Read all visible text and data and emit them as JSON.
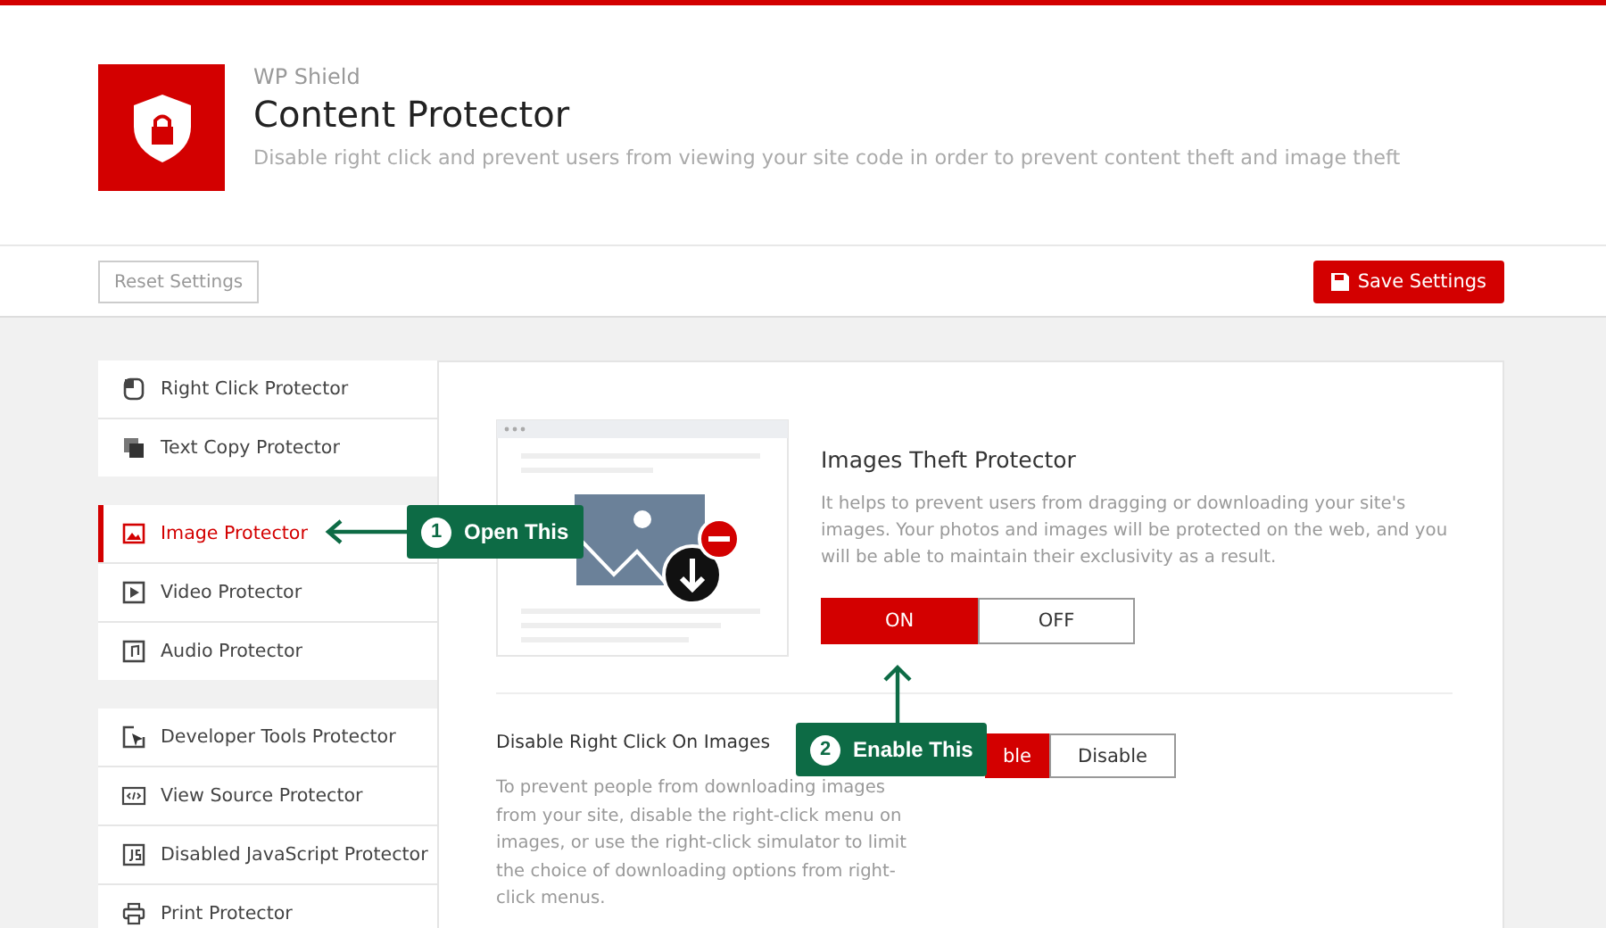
{
  "header": {
    "brand": "WP Shield",
    "title": "Content Protector",
    "subtitle": "Disable right click and prevent users from viewing your site code in order to prevent content theft and image theft"
  },
  "toolbar": {
    "reset": "Reset Settings",
    "save": "Save Settings"
  },
  "sidebar": {
    "groups": [
      {
        "items": [
          {
            "label": "Right Click Protector",
            "kind": "mouse",
            "selected": false
          },
          {
            "label": "Text Copy Protector",
            "kind": "copy",
            "selected": false
          }
        ]
      },
      {
        "items": [
          {
            "label": "Image Protector",
            "kind": "image",
            "selected": true
          },
          {
            "label": "Video Protector",
            "kind": "video",
            "selected": false
          },
          {
            "label": "Audio Protector",
            "kind": "audio",
            "selected": false
          }
        ]
      },
      {
        "items": [
          {
            "label": "Developer Tools Protector",
            "kind": "cursor",
            "selected": false
          },
          {
            "label": "View Source Protector",
            "kind": "code",
            "selected": false
          },
          {
            "label": "Disabled JavaScript Protector",
            "kind": "script",
            "selected": false
          },
          {
            "label": "Print Protector",
            "kind": "print",
            "selected": false
          }
        ]
      }
    ]
  },
  "feature": {
    "title": "Images Theft Protector",
    "description": "It helps to prevent users from dragging or downloading your site's images. Your photos and images will be protected on the web, and you will be able to maintain their exclusivity as a result.",
    "options": [
      {
        "label": "ON",
        "selected": true
      },
      {
        "label": "OFF",
        "selected": false
      }
    ]
  },
  "setting": {
    "title": "Disable Right Click On Images",
    "description": "To prevent people from downloading images from your site, disable the right-click menu on images, or use the right-click simulator to limit the choice of downloading options from right-click menus.",
    "options": [
      {
        "label": "ble",
        "selected": true
      },
      {
        "label": "Disable",
        "selected": false
      }
    ]
  },
  "callouts": [
    {
      "number": "1",
      "label": "Open This",
      "kind": "left"
    },
    {
      "number": "2",
      "label": "Enable This",
      "kind": "up"
    }
  ]
}
